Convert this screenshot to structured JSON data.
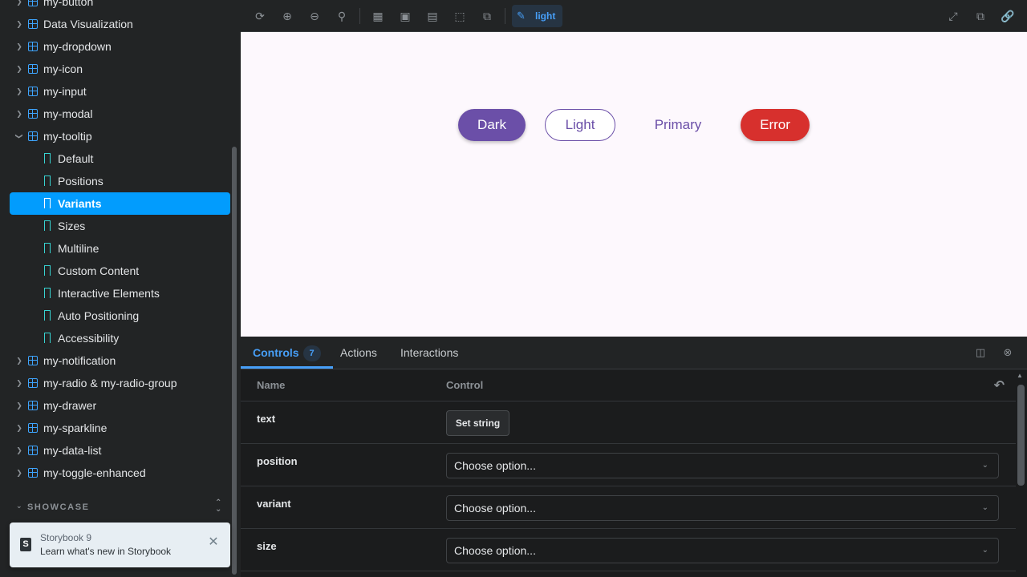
{
  "sidebar": {
    "items": [
      {
        "label": "my-button",
        "type": "component",
        "expanded": false
      },
      {
        "label": "Data Visualization",
        "type": "component",
        "expanded": false
      },
      {
        "label": "my-dropdown",
        "type": "component",
        "expanded": false
      },
      {
        "label": "my-icon",
        "type": "component",
        "expanded": false
      },
      {
        "label": "my-input",
        "type": "component",
        "expanded": false
      },
      {
        "label": "my-modal",
        "type": "component",
        "expanded": false
      },
      {
        "label": "my-tooltip",
        "type": "component",
        "expanded": true
      },
      {
        "label": "Default",
        "type": "story"
      },
      {
        "label": "Positions",
        "type": "story"
      },
      {
        "label": "Variants",
        "type": "story",
        "selected": true
      },
      {
        "label": "Sizes",
        "type": "story"
      },
      {
        "label": "Multiline",
        "type": "story"
      },
      {
        "label": "Custom Content",
        "type": "story"
      },
      {
        "label": "Interactive Elements",
        "type": "story"
      },
      {
        "label": "Auto Positioning",
        "type": "story"
      },
      {
        "label": "Accessibility",
        "type": "story"
      },
      {
        "label": "my-notification",
        "type": "component",
        "expanded": false
      },
      {
        "label": "my-radio & my-radio-group",
        "type": "component",
        "expanded": false
      },
      {
        "label": "my-drawer",
        "type": "component",
        "expanded": false
      },
      {
        "label": "my-sparkline",
        "type": "component",
        "expanded": false
      },
      {
        "label": "my-data-list",
        "type": "component",
        "expanded": false
      },
      {
        "label": "my-toggle-enhanced",
        "type": "component",
        "expanded": false
      }
    ],
    "section_title": "SHOWCASE"
  },
  "toast": {
    "title": "Storybook 9",
    "message": "Learn what's new in Storybook"
  },
  "toolbar": {
    "buttons_left": [
      "remount-icon",
      "zoom-in-icon",
      "zoom-out-icon",
      "zoom-reset-icon",
      "grid-icon",
      "background-icon",
      "viewport-icon",
      "outline-icon",
      "measure-icon"
    ],
    "theme_label": "light",
    "buttons_right": [
      "fullscreen-icon",
      "open-new-tab-icon",
      "copy-link-icon"
    ]
  },
  "canvas": {
    "background": "#fdf8fd",
    "buttons": [
      {
        "label": "Dark",
        "variant": "dark",
        "color": "#6b4fa8"
      },
      {
        "label": "Light",
        "variant": "light",
        "color": "#ffffff"
      },
      {
        "label": "Primary",
        "variant": "primary",
        "color": "#6b4fa8"
      },
      {
        "label": "Error",
        "variant": "error",
        "color": "#d7302d"
      }
    ]
  },
  "panel": {
    "tabs": [
      {
        "label": "Controls",
        "badge": "7",
        "active": true
      },
      {
        "label": "Actions"
      },
      {
        "label": "Interactions"
      }
    ],
    "columns": {
      "name": "Name",
      "control": "Control"
    },
    "rows": [
      {
        "name": "text",
        "control": "button",
        "value": "Set string"
      },
      {
        "name": "position",
        "control": "select",
        "value": "Choose option..."
      },
      {
        "name": "variant",
        "control": "select",
        "value": "Choose option..."
      },
      {
        "name": "size",
        "control": "select",
        "value": "Choose option..."
      }
    ]
  },
  "colors": {
    "accent": "#029cfd",
    "link_blue": "#479ff8",
    "component_icon": "#3ea5ff",
    "story_icon": "#37d5d3"
  }
}
